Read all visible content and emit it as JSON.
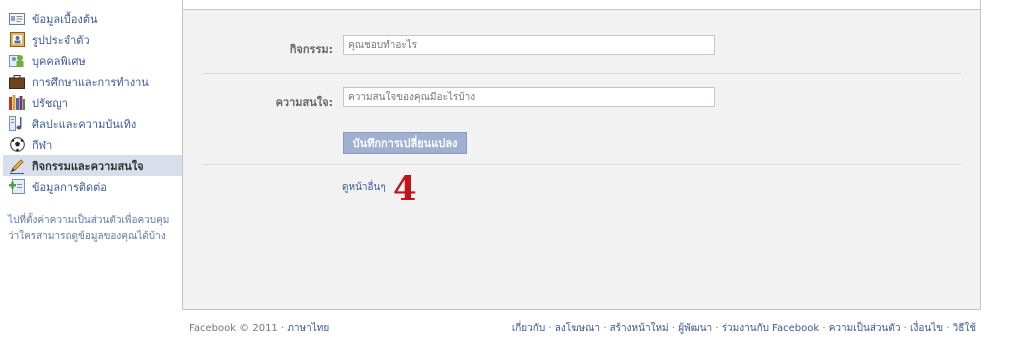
{
  "sidebar": {
    "items": [
      {
        "label": "ข้อมูลเบื้องต้น",
        "icon": "id-card-icon"
      },
      {
        "label": "รูปประจำตัว",
        "icon": "profile-picture-icon"
      },
      {
        "label": "บุคคลพิเศษ",
        "icon": "people-icon"
      },
      {
        "label": "การศึกษาและการทำงาน",
        "icon": "briefcase-icon"
      },
      {
        "label": "ปรัชญา",
        "icon": "books-icon"
      },
      {
        "label": "ศิลปะและความบันเทิง",
        "icon": "music-icon"
      },
      {
        "label": "กีฬา",
        "icon": "soccer-ball-icon"
      },
      {
        "label": "กิจกรรมและความสนใจ",
        "icon": "pencil-icon"
      },
      {
        "label": "ข้อมูลการติดต่อ",
        "icon": "contact-icon"
      }
    ],
    "note": "ไปที่ตั้งค่าความเป็นส่วนตัวเพื่อควบคุมว่าใครสามารถดูข้อมูลของคุณได้บ้าง"
  },
  "form": {
    "activities": {
      "label": "กิจกรรม:",
      "placeholder": "คุณชอบทำอะไร"
    },
    "interests": {
      "label": "ความสนใจ:",
      "placeholder": "ความสนใจของคุณมีอะไรบ้าง"
    },
    "save_label": "บันทึกการเปลี่ยนแปลง",
    "see_more": "ดูหน้าอื่นๆ"
  },
  "annotation": "4",
  "footer": {
    "copyright": "Facebook © 2011 · ",
    "language": "ภาษาไทย",
    "links": [
      "เกี่ยวกับ",
      "ลงโฆษณา",
      "สร้างหน้าใหม่",
      "ผู้พัฒนา",
      "ร่วมงานกับ Facebook",
      "ความเป็นส่วนตัว",
      "เงื่อนไข",
      "วิธีใช้"
    ]
  },
  "colors": {
    "link": "#3b5998",
    "active_bg": "#d8dfea",
    "panel_bg": "#f2f2f2",
    "annotation": "#c0141c"
  }
}
